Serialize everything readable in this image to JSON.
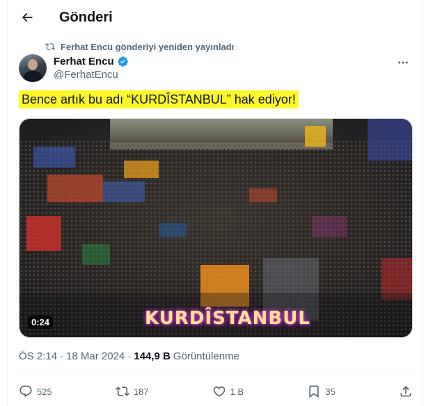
{
  "header": {
    "title": "Gönderi"
  },
  "repost": {
    "text": "Ferhat Encu gönderiyi yeniden yayınladı"
  },
  "author": {
    "name": "Ferhat Encu",
    "handle": "@FerhatEncu"
  },
  "tweet": {
    "text": "Bence artık bu adı “KURDÎSTANBUL” hak ediyor!"
  },
  "media": {
    "duration": "0:24",
    "overlay": "KURDÎSTANBUL"
  },
  "meta": {
    "time": "ÖS 2:14",
    "date": "18 Mar 2024",
    "views_count": "144,9 B",
    "views_label": "Görüntülenme"
  },
  "actions": {
    "replies": "525",
    "reposts": "187",
    "likes": "1 B",
    "bookmarks": "35"
  },
  "colors": {
    "highlight": "#fff72b",
    "verified": "#1d9bf0",
    "muted": "#536471"
  }
}
